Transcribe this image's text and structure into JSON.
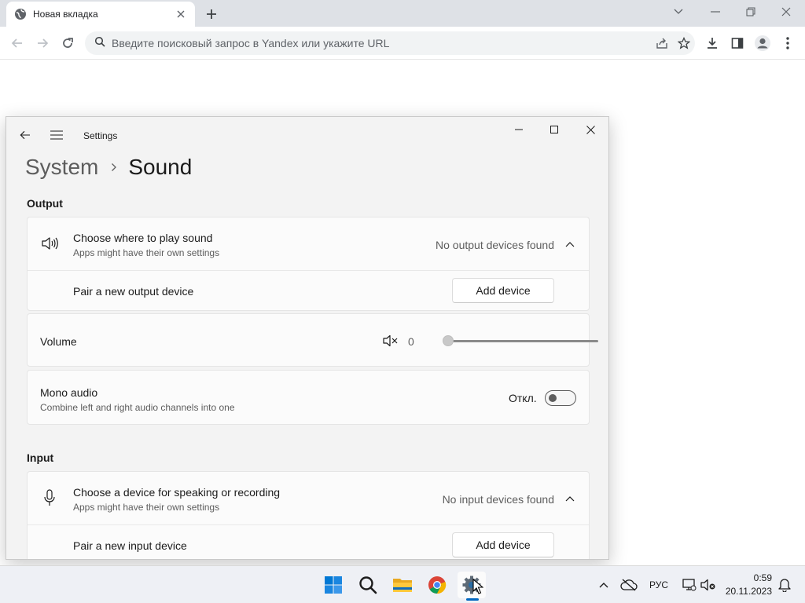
{
  "browser": {
    "tab_title": "Новая вкладка",
    "omnibox_placeholder": "Введите поисковый запрос в Yandex или укажите URL"
  },
  "settings": {
    "window_title": "Settings",
    "breadcrumb": {
      "parent": "System",
      "current": "Sound"
    },
    "output": {
      "section_title": "Output",
      "choose_title": "Choose where to play sound",
      "choose_sub": "Apps might have their own settings",
      "choose_status": "No output devices found",
      "pair_label": "Pair a new output device",
      "add_device": "Add device",
      "volume_label": "Volume",
      "volume_value": "0",
      "volume_level": 0,
      "mono_title": "Mono audio",
      "mono_sub": "Combine left and right audio channels into one",
      "mono_state": "Откл."
    },
    "input": {
      "section_title": "Input",
      "choose_title": "Choose a device for speaking or recording",
      "choose_sub": "Apps might have their own settings",
      "choose_status": "No input devices found",
      "pair_label": "Pair a new input device",
      "add_device": "Add device"
    }
  },
  "taskbar": {
    "apps": [
      "windows-start-icon",
      "search-icon",
      "file-explorer-icon",
      "chrome-icon",
      "settings-icon"
    ],
    "tray": {
      "language": "РУС",
      "time": "0:59",
      "date": "20.11.2023"
    }
  },
  "colors": {
    "accent": "#0067c0",
    "window_bg": "#f3f3f3",
    "card_bg": "#fbfbfb",
    "taskbar_bg": "#eef0f5"
  }
}
